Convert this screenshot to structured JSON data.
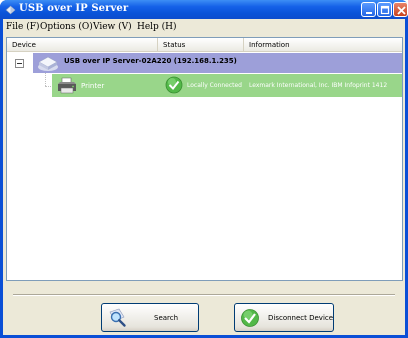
{
  "window": {
    "title": "USB over IP Server",
    "title_bar_color": "#0a53d8"
  },
  "menu": {
    "items": [
      {
        "label": "File (F)"
      },
      {
        "label": "Options (O)"
      },
      {
        "label": "View (V)"
      },
      {
        "label": "Help (H)"
      }
    ]
  },
  "list": {
    "columns": [
      "Device",
      "Status",
      "Information"
    ],
    "server": {
      "label": "USB over IP Server-02A220 (192.168.1.235)",
      "row_color": "#9d9fd9",
      "expanded": true
    },
    "devices": [
      {
        "name": "Printer",
        "status": "Locally Connected",
        "information": "Lexmark International, Inc. IBM Infoprint 1412",
        "row_color": "#99d68a"
      }
    ]
  },
  "buttons": {
    "search": "Search",
    "disconnect": "Disconnect Device"
  },
  "icons": {
    "app": "usb-server-icon",
    "server": "server-icon",
    "printer": "printer-icon",
    "status": "green-check-icon",
    "search": "magnifier-search-icon",
    "disconnect": "green-check-icon"
  }
}
